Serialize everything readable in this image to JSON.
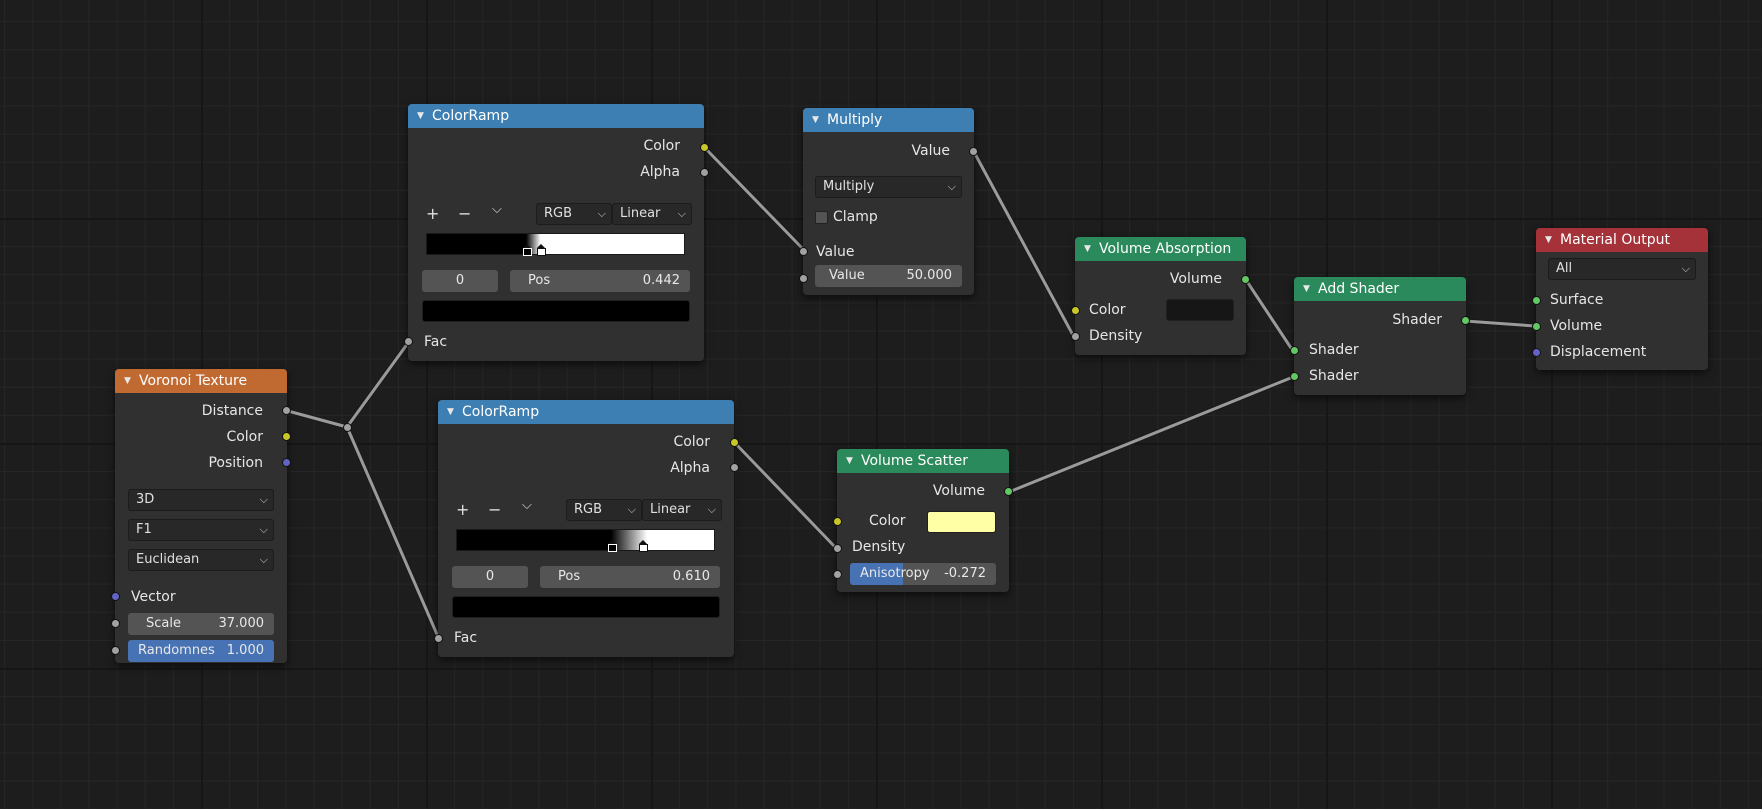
{
  "colors": {
    "header_colorramp": "#3d7fb2",
    "header_texture": "#c06a32",
    "header_shader": "#2a8a5c",
    "header_output": "#a53139",
    "absorption_color": "#161616",
    "scatter_color": "#ffffa6"
  },
  "icons": {
    "collapse": "triangle-down-icon",
    "add": "plus-icon",
    "remove": "minus-icon",
    "menu": "chevron-down-icon"
  },
  "voronoi": {
    "title": "Voronoi Texture",
    "outputs": [
      "Distance",
      "Color",
      "Position"
    ],
    "dims": "3D",
    "feature": "F1",
    "metric": "Euclidean",
    "vector_label": "Vector",
    "scale_label": "Scale",
    "scale_value": "37.000",
    "random_label": "Randomnes",
    "random_value": "1.000"
  },
  "ramp1": {
    "title": "ColorRamp",
    "out_color": "Color",
    "out_alpha": "Alpha",
    "add_icon": "+",
    "remove_icon": "−",
    "menu_icon": "⌵",
    "mode": "RGB",
    "interp": "Linear",
    "index": "0",
    "pos_label": "Pos",
    "pos_value": "0.442",
    "fac_label": "Fac"
  },
  "ramp2": {
    "title": "ColorRamp",
    "out_color": "Color",
    "out_alpha": "Alpha",
    "add_icon": "+",
    "remove_icon": "−",
    "menu_icon": "⌵",
    "mode": "RGB",
    "interp": "Linear",
    "index": "0",
    "pos_label": "Pos",
    "pos_value": "0.610",
    "fac_label": "Fac"
  },
  "multiply": {
    "title": "Multiply",
    "out_value": "Value",
    "operation": "Multiply",
    "clamp_label": "Clamp",
    "in_value": "Value",
    "value_label": "Value",
    "value_value": "50.000"
  },
  "absorption": {
    "title": "Volume Absorption",
    "out_volume": "Volume",
    "color_label": "Color",
    "density_label": "Density"
  },
  "scatter": {
    "title": "Volume Scatter",
    "out_volume": "Volume",
    "color_label": "Color",
    "density_label": "Density",
    "aniso_label": "Anisotropy",
    "aniso_value": "-0.272",
    "aniso_fill_fraction": 0.36
  },
  "addshader": {
    "title": "Add Shader",
    "out_shader": "Shader",
    "in1": "Shader",
    "in2": "Shader"
  },
  "output": {
    "title": "Material Output",
    "target": "All",
    "surface": "Surface",
    "volume": "Volume",
    "displacement": "Displacement"
  }
}
